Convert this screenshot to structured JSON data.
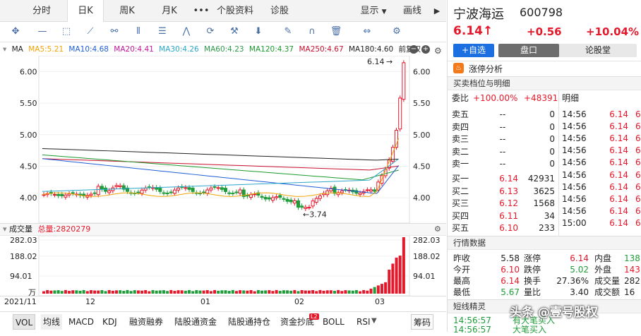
{
  "tabs": {
    "fenshi": "分时",
    "rik": "日K",
    "zhouk": "周K",
    "yuek": "月K",
    "more": "•••",
    "profile": "个股资料",
    "diagnose": "诊股",
    "display": "显示",
    "draw": "画线"
  },
  "ma": {
    "label": "MA",
    "ma5": "MA5:5.21",
    "ma10": "MA10:4.68",
    "ma20": "MA20:4.41",
    "ma30": "MA30:4.26",
    "ma60": "MA60:4.23",
    "ma120": "MA120:4.37",
    "ma250": "MA250:4.67",
    "ma180": "MA180:4.60",
    "fq": "前复权"
  },
  "volume": {
    "label": "成交量",
    "total": "总量:2820279"
  },
  "colors": {
    "ma5": "#f0a30a",
    "ma10": "#1e5fd6",
    "ma20": "#c2189c",
    "ma30": "#2aa6c9",
    "ma60": "#2e9a4a",
    "ma120": "#1c9a2e",
    "ma250": "#c8102e",
    "ma180": "#222222",
    "up": "#e4182b",
    "down": "#1f9d3a"
  },
  "chart_data": {
    "type": "candlestick",
    "y_ticks": [
      "6.00",
      "5.50",
      "5.00",
      "4.50",
      "4.00"
    ],
    "ylim": [
      3.6,
      6.25
    ],
    "high_label": "6.14",
    "low_label": "3.74",
    "vol_ticks": [
      "282.03",
      "188.02",
      "94.01",
      "万"
    ],
    "vol_ylim": [
      0,
      282.03
    ],
    "x_labels": [
      "2021/11",
      "12",
      "01",
      "02",
      "03"
    ]
  },
  "stock": {
    "name": "宁波海运",
    "code": "600798",
    "price": "6.14",
    "arrow": "↑",
    "change": "+0.56",
    "pct": "+10.04%"
  },
  "buttons": {
    "add": "+自选",
    "pankou": "盘口",
    "luntang": "论股堂"
  },
  "zt": "涨停分析",
  "ob": {
    "title": "买卖档位与明细",
    "weibi_label": "委比",
    "weibi": "+100.00%",
    "weicha": "+48391",
    "mingxi": "明细",
    "sells": [
      {
        "n": "卖五",
        "p": "--",
        "v": "0"
      },
      {
        "n": "卖四",
        "p": "--",
        "v": "0"
      },
      {
        "n": "卖三",
        "p": "--",
        "v": "0"
      },
      {
        "n": "卖二",
        "p": "--",
        "v": "0"
      },
      {
        "n": "卖一",
        "p": "--",
        "v": "0"
      }
    ],
    "buys": [
      {
        "n": "买一",
        "p": "6.14",
        "v": "42931"
      },
      {
        "n": "买二",
        "p": "6.13",
        "v": "3625"
      },
      {
        "n": "买三",
        "p": "6.12",
        "v": "1568"
      },
      {
        "n": "买四",
        "p": "6.11",
        "v": "34"
      },
      {
        "n": "买五",
        "p": "6.10",
        "v": "233"
      }
    ]
  },
  "ticks": [
    {
      "t": "14:56",
      "p": "6.14",
      "v": "6"
    },
    {
      "t": "14:56",
      "p": "6.14",
      "v": "6"
    },
    {
      "t": "14:56",
      "p": "6.14",
      "v": "6"
    },
    {
      "t": "14:56",
      "p": "6.14",
      "v": "6"
    },
    {
      "t": "14:56",
      "p": "6.14",
      "v": "6"
    },
    {
      "t": "14:56",
      "p": "6.14",
      "v": "6"
    },
    {
      "t": "14:56",
      "p": "6.14",
      "v": "6"
    },
    {
      "t": "14:56",
      "p": "6.14",
      "v": "6"
    },
    {
      "t": "14:56",
      "p": "6.14",
      "v": "6"
    },
    {
      "t": "15:00",
      "p": "6.14",
      "v": "6"
    }
  ],
  "quote": {
    "title": "行情数据",
    "rows": [
      {
        "a": "昨收",
        "av": "5.58",
        "b": "涨停",
        "bv": "6.14",
        "c": "内盘",
        "cv": "138"
      },
      {
        "a": "今开",
        "av": "6.10",
        "b": "跌停",
        "bv": "5.02",
        "c": "外盘",
        "cv": "143"
      },
      {
        "a": "最高",
        "av": "6.14",
        "b": "换手",
        "bv": "27.36%",
        "c": "成交量",
        "cv": "282"
      },
      {
        "a": "最低",
        "av": "5.67",
        "b": "量比",
        "bv": "3.40",
        "c": "成交额",
        "cv": "16"
      }
    ]
  },
  "short": {
    "title": "短线精灵",
    "rows": [
      {
        "t": "14:56:57",
        "txt": "有大笔买入"
      },
      {
        "t": "14:56:57",
        "txt": "大笔买入"
      }
    ]
  },
  "watermark": "头条 @壹号股权",
  "bottom": {
    "vol": "VOL",
    "jx": "均线",
    "macd": "MACD",
    "kdj": "KDJ",
    "rzrq": "融资融券",
    "lgt_zj": "陆股通资金",
    "lgt_cc": "陆股通持仓",
    "zjcd": "资金抄底",
    "badge": "L2",
    "boll": "BOLL",
    "rsi": "RSI",
    "chouma": "筹码"
  }
}
